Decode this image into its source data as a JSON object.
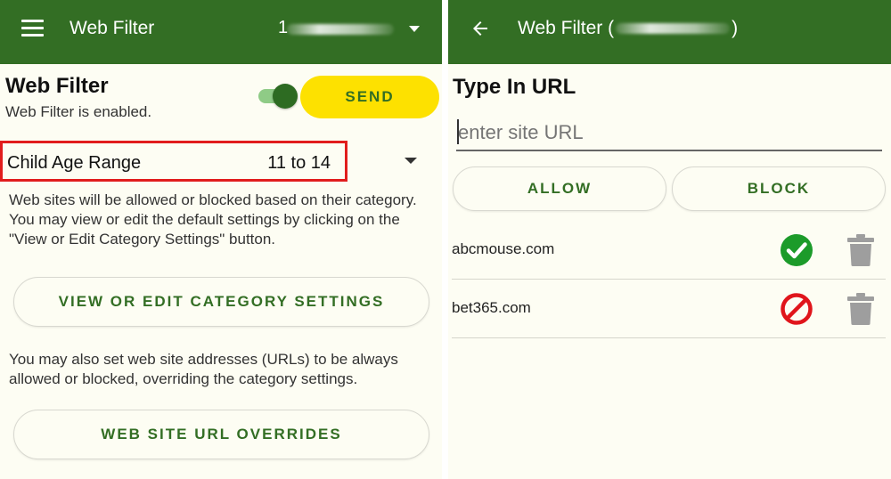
{
  "left_panel": {
    "appbar": {
      "title": "Web Filter",
      "account_prefix": "1",
      "icons": [
        "menu-icon",
        "chevron-down-icon"
      ]
    },
    "web_filter": {
      "heading": "Web Filter",
      "status": "Web Filter is enabled.",
      "toggle_on": true,
      "send_label": "SEND"
    },
    "age_range": {
      "label": "Child Age Range",
      "value": "11 to 14"
    },
    "category_description": "Web sites will be allowed or blocked based on their category. You may view or edit the default settings by clicking on the \"View or Edit Category Settings\" button.",
    "category_button_label": "VIEW OR EDIT CATEGORY SETTINGS",
    "override_description": "You may also set web site addresses (URLs) to be always allowed or blocked, overriding the category settings.",
    "override_button_label": "WEB SITE URL OVERRIDES"
  },
  "right_panel": {
    "appbar": {
      "title_prefix": "Web Filter (",
      "title_suffix": ")",
      "icons": [
        "back-arrow-icon"
      ]
    },
    "heading": "Type In URL",
    "url_input": {
      "value": "",
      "placeholder": "enter site URL"
    },
    "allow_label": "ALLOW",
    "block_label": "BLOCK",
    "url_list": [
      {
        "url": "abcmouse.com",
        "status": "allowed",
        "status_icon": "check-circle-icon",
        "delete_icon": "trash-icon"
      },
      {
        "url": "bet365.com",
        "status": "blocked",
        "status_icon": "block-circle-icon",
        "delete_icon": "trash-icon"
      }
    ]
  },
  "colors": {
    "appbar": "#336e24",
    "background": "#fdfdf3",
    "accent_green": "#336e24",
    "send_yellow": "#fde100",
    "toggle_track": "#8fcb86",
    "highlight_red": "#e11d1d",
    "allowed_green": "#1c9b2a",
    "blocked_red": "#e0151b",
    "trash_gray": "#9e9e9e"
  }
}
